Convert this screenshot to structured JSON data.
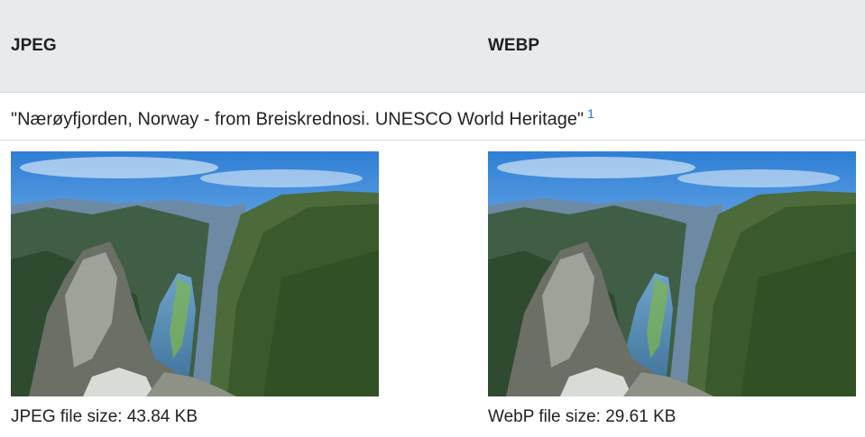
{
  "table": {
    "headers": [
      "JPEG",
      "WEBP"
    ],
    "caption": "\"Nærøyfjorden, Norway - from Breiskrednosi. UNESCO World Heritage\"",
    "footnote": "1",
    "images": [
      {
        "format": "JPEG",
        "size_label": "JPEG file size: 43.84 KB"
      },
      {
        "format": "WEBP",
        "size_label": "WebP file size: 29.61 KB"
      }
    ]
  },
  "colors": {
    "header_bg": "#e8eaed",
    "text": "#202124",
    "link": "#1a73e8",
    "divider": "#dadce0"
  }
}
